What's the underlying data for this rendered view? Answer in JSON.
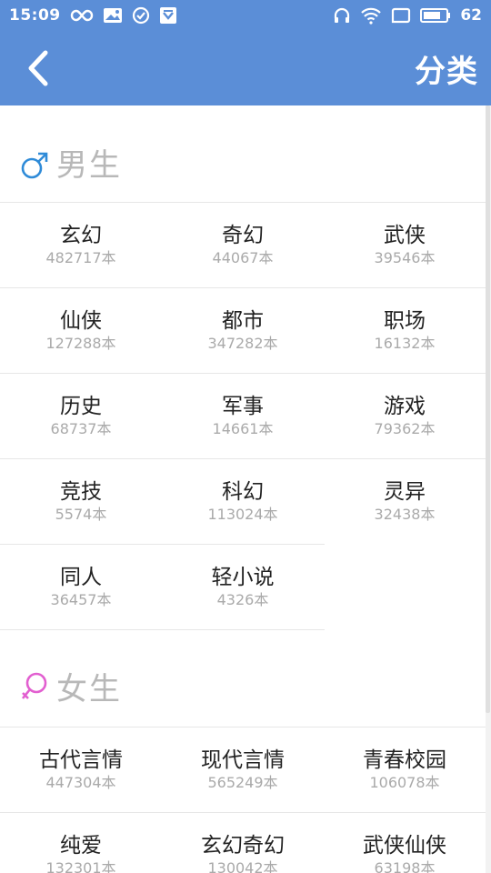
{
  "status_bar": {
    "time": "15:09",
    "battery": "62",
    "left_icons": [
      "infinity-icon",
      "mail-icon",
      "check-circle-icon",
      "shield-icon"
    ],
    "right_icons": [
      "headset-icon",
      "wifi-icon",
      "screen-icon",
      "battery-icon"
    ]
  },
  "app_bar": {
    "back_icon": "chevron-left-icon",
    "title": "分类"
  },
  "colors": {
    "primary": "#5b8ed7",
    "male": "#2f8bd8",
    "female": "#e25fd0",
    "section_title": "#b8b8b8",
    "count_text": "#aaaaaa"
  },
  "sections": [
    {
      "id": "male",
      "title": "男生",
      "icon": "male-symbol-icon",
      "categories": [
        {
          "name": "玄幻",
          "count": "482717本"
        },
        {
          "name": "奇幻",
          "count": "44067本"
        },
        {
          "name": "武侠",
          "count": "39546本"
        },
        {
          "name": "仙侠",
          "count": "127288本"
        },
        {
          "name": "都市",
          "count": "347282本"
        },
        {
          "name": "职场",
          "count": "16132本"
        },
        {
          "name": "历史",
          "count": "68737本"
        },
        {
          "name": "军事",
          "count": "14661本"
        },
        {
          "name": "游戏",
          "count": "79362本"
        },
        {
          "name": "竞技",
          "count": "5574本"
        },
        {
          "name": "科幻",
          "count": "113024本"
        },
        {
          "name": "灵异",
          "count": "32438本"
        },
        {
          "name": "同人",
          "count": "36457本"
        },
        {
          "name": "轻小说",
          "count": "4326本"
        }
      ]
    },
    {
      "id": "female",
      "title": "女生",
      "icon": "female-symbol-icon",
      "categories": [
        {
          "name": "古代言情",
          "count": "447304本"
        },
        {
          "name": "现代言情",
          "count": "565249本"
        },
        {
          "name": "青春校园",
          "count": "106078本"
        },
        {
          "name": "纯爱",
          "count": "132301本"
        },
        {
          "name": "玄幻奇幻",
          "count": "130042本"
        },
        {
          "name": "武侠仙侠",
          "count": "63198本"
        }
      ]
    }
  ]
}
